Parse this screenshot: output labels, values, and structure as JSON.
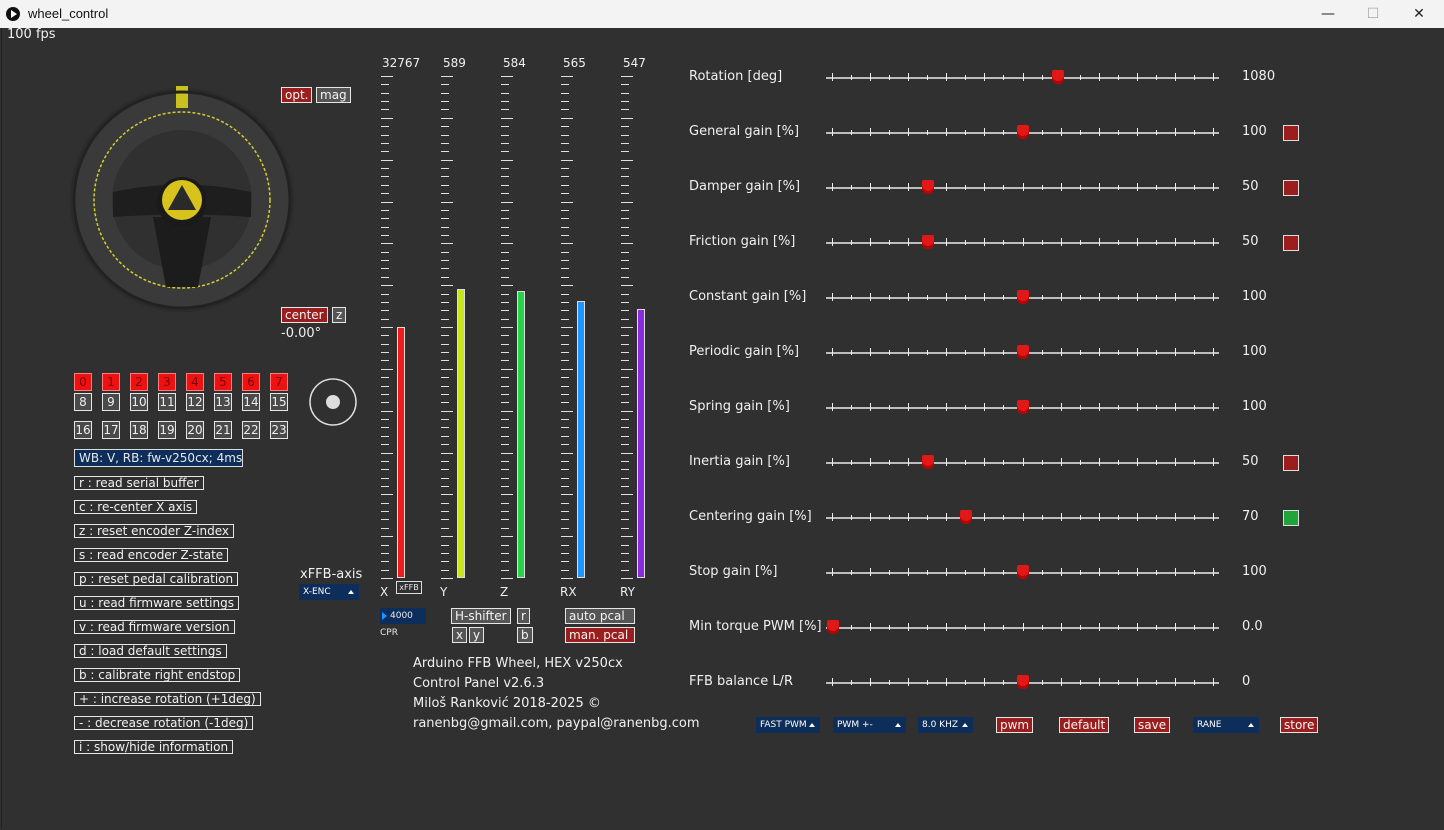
{
  "window": {
    "title": "wheel_control",
    "min": "—",
    "max": "☐",
    "close": "✕"
  },
  "fps": "100 fps",
  "wheel": {
    "mode_opt": "opt.",
    "mode_mag": "mag",
    "center_label": "center",
    "z_label": "z",
    "angle": "-0.00°"
  },
  "buttons_row1": [
    "0",
    "1",
    "2",
    "3",
    "4",
    "5",
    "6",
    "7"
  ],
  "buttons_row2": [
    "8",
    "9",
    "10",
    "11",
    "12",
    "13",
    "14",
    "15"
  ],
  "buttons_row3": [
    "16",
    "17",
    "18",
    "19",
    "20",
    "21",
    "22",
    "23"
  ],
  "info_box": "WB: V, RB: fw-v250cx; 4ms",
  "commands": [
    "r : read serial buffer",
    "c : re-center X axis",
    "z : reset encoder Z-index",
    "s : read encoder Z-state",
    "p : reset pedal calibration",
    "u : read firmware settings",
    "v : read firmware version",
    "d : load default settings",
    "b : calibrate right endstop",
    "+ : increase rotation (+1deg)",
    "- : decrease rotation (-1deg)",
    "i : show/hide information"
  ],
  "xffb": {
    "label": "xFFB-axis",
    "value": "X-ENC"
  },
  "axes": [
    {
      "name": "X",
      "value": "32767",
      "level": 0.5,
      "color": "#ee1c1c"
    },
    {
      "name": "Y",
      "value": "589",
      "level": 0.575,
      "color": "#c8e61e"
    },
    {
      "name": "Z",
      "value": "584",
      "level": 0.571,
      "color": "#28d24a"
    },
    {
      "name": "RX",
      "value": "565",
      "level": 0.552,
      "color": "#1e96ff"
    },
    {
      "name": "RY",
      "value": "547",
      "level": 0.535,
      "color": "#8a2be2"
    }
  ],
  "xffb_tag": "xFFB",
  "cpr": {
    "value": "4000",
    "label": "CPR"
  },
  "shifter": {
    "label": "H-shifter",
    "r": "r",
    "x": "x",
    "y": "y",
    "b": "b"
  },
  "pcal": {
    "auto": "auto pcal",
    "man": "man. pcal"
  },
  "about": [
    "Arduino FFB Wheel, HEX v250cx",
    "Control Panel v2.6.3",
    "Miloš Ranković 2018-2025 ©",
    "ranenbg@gmail.com, paypal@ranenbg.com"
  ],
  "sliders": [
    {
      "label": "Rotation [deg]",
      "value": "1080",
      "pos": 0.593,
      "box": ""
    },
    {
      "label": "General gain [%]",
      "value": "100",
      "pos": 0.5,
      "box": "red"
    },
    {
      "label": "Damper gain [%]",
      "value": "50",
      "pos": 0.25,
      "box": "red"
    },
    {
      "label": "Friction gain [%]",
      "value": "50",
      "pos": 0.25,
      "box": "red"
    },
    {
      "label": "Constant gain [%]",
      "value": "100",
      "pos": 0.5,
      "box": ""
    },
    {
      "label": "Periodic gain [%]",
      "value": "100",
      "pos": 0.5,
      "box": ""
    },
    {
      "label": "Spring gain [%]",
      "value": "100",
      "pos": 0.5,
      "box": ""
    },
    {
      "label": "Inertia gain [%]",
      "value": "50",
      "pos": 0.25,
      "box": "red"
    },
    {
      "label": "Centering gain [%]",
      "value": "70",
      "pos": 0.35,
      "box": "green"
    },
    {
      "label": "Stop gain [%]",
      "value": "100",
      "pos": 0.5,
      "box": ""
    },
    {
      "label": "Min torque PWM [%]",
      "value": "0.0",
      "pos": 0.0,
      "box": ""
    },
    {
      "label": "FFB balance L/R",
      "value": "0",
      "pos": 0.5,
      "box": ""
    }
  ],
  "bottom": {
    "pwm_freq_mode": "FAST PWM",
    "pwm_dir": "PWM +-",
    "pwm_khz": "8.0 KHZ",
    "pwm": "pwm",
    "default": "default",
    "save": "save",
    "profile": "RANE",
    "store": "store"
  }
}
